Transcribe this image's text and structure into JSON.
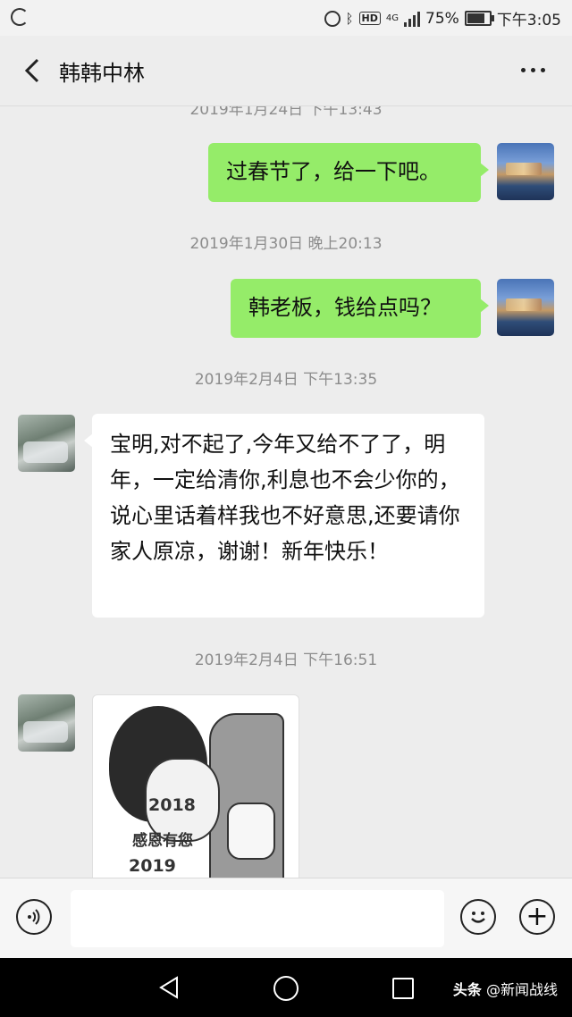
{
  "status_bar": {
    "signal": "4G",
    "battery": "75%",
    "time": "下午3:05",
    "hd": "HD"
  },
  "header": {
    "title": "韩韩中林"
  },
  "messages": [
    {
      "type": "timestamp",
      "text": "2019年1月24日 下午13:43"
    },
    {
      "type": "text",
      "sender": "me",
      "text": "过春节了，给一下吧。"
    },
    {
      "type": "timestamp",
      "text": "2019年1月30日 晚上20:13"
    },
    {
      "type": "text",
      "sender": "me",
      "text": "韩老板，钱给点吗？"
    },
    {
      "type": "timestamp",
      "text": "2019年2月4日 下午13:35"
    },
    {
      "type": "text",
      "sender": "other",
      "text": "宝明,对不起了,今年又给不了了，明年，一定给清你,利息也不会少你的，说心里话着样我也不好意思,还要请你家人原凉，谢谢！新年快乐！"
    },
    {
      "type": "timestamp",
      "text": "2019年2月4日 下午16:51"
    },
    {
      "type": "sticker",
      "sender": "other",
      "lines": [
        "2018",
        "感恩有您",
        "2019"
      ]
    }
  ],
  "input": {
    "placeholder": ""
  },
  "navbar": {
    "watermark_brand": "头条",
    "watermark_account": "@新闻战线"
  },
  "colors": {
    "my_bubble": "#95ec69",
    "their_bubble": "#ffffff",
    "background": "#ededed"
  }
}
